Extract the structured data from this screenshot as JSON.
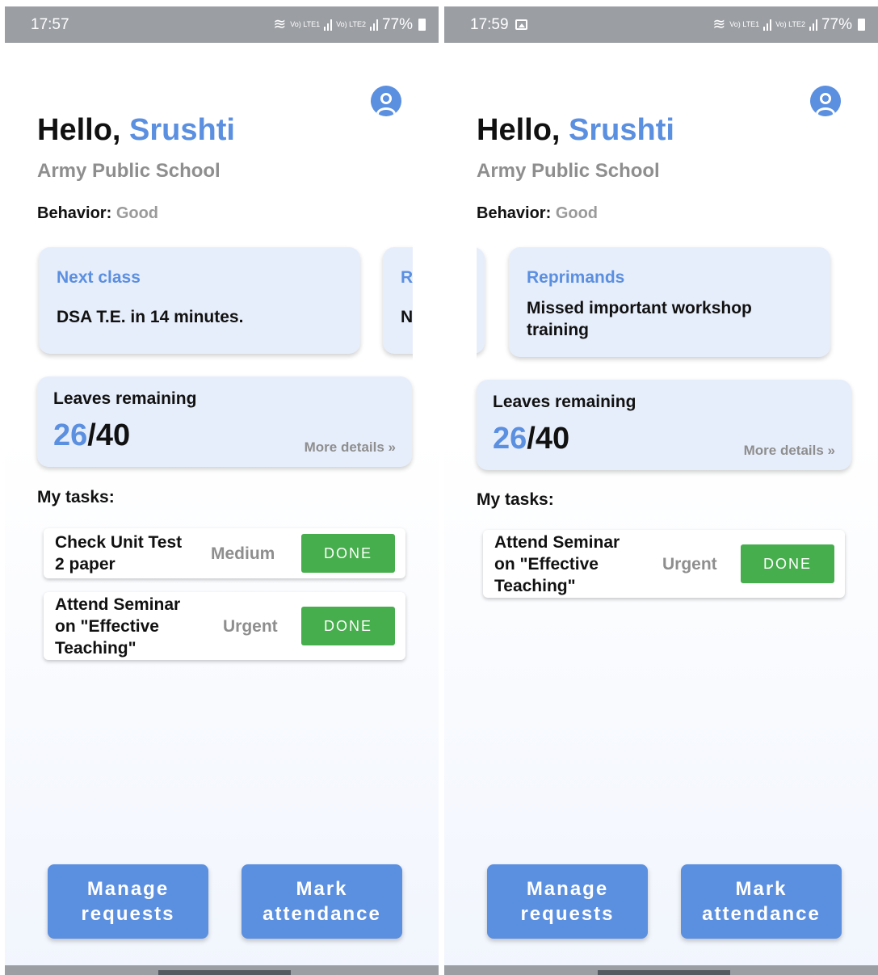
{
  "screens": {
    "left": {
      "status": {
        "time": "17:57",
        "battery": "77%",
        "sim1": "Vo) LTE1",
        "sim2": "Vo) LTE2"
      },
      "greeting": {
        "hello": "Hello, ",
        "name": "Srushti"
      },
      "school": "Army Public School",
      "behavior": {
        "label": "Behavior: ",
        "value": "Good"
      },
      "cards": [
        {
          "title": "Next class",
          "body": "DSA T.E. in 14 minutes."
        },
        {
          "title": "R",
          "body": "N"
        }
      ],
      "leaves": {
        "title": "Leaves remaining",
        "used": "26",
        "total": "/40",
        "more": "More details »"
      },
      "tasks_label": "My tasks:",
      "tasks": [
        {
          "line1": "Check Unit Test",
          "line2": "2 paper",
          "priority": "Medium",
          "button": "DONE"
        },
        {
          "line1": "Attend Seminar",
          "line2": "on \"Effective",
          "line3": "Teaching\"",
          "priority": "Urgent",
          "button": "DONE"
        }
      ],
      "buttons": {
        "manage_1": "Manage",
        "manage_2": "requests",
        "mark_1": "Mark",
        "mark_2": "attendance"
      }
    },
    "right": {
      "status": {
        "time": "17:59",
        "battery": "77%",
        "sim1": "Vo) LTE1",
        "sim2": "Vo) LTE2"
      },
      "greeting": {
        "hello": "Hello, ",
        "name": "Srushti"
      },
      "school": "Army Public School",
      "behavior": {
        "label": "Behavior: ",
        "value": "Good"
      },
      "cards": [
        {
          "title": "Reprimands",
          "body_1": "Missed important workshop",
          "body_2": "training"
        }
      ],
      "leaves": {
        "title": "Leaves remaining",
        "used": "26",
        "total": "/40",
        "more": "More details »"
      },
      "tasks_label": "My tasks:",
      "tasks": [
        {
          "line1": "Attend Seminar",
          "line2": "on \"Effective",
          "line3": "Teaching\"",
          "priority": "Urgent",
          "button": "DONE"
        }
      ],
      "buttons": {
        "manage_1": "Manage",
        "manage_2": "requests",
        "mark_1": "Mark",
        "mark_2": "attendance"
      }
    }
  },
  "colors": {
    "accent": "#5b8fe0",
    "done_green": "#47ae4d",
    "card_bg": "#e7eefb",
    "muted_text": "#8e8e8e"
  }
}
